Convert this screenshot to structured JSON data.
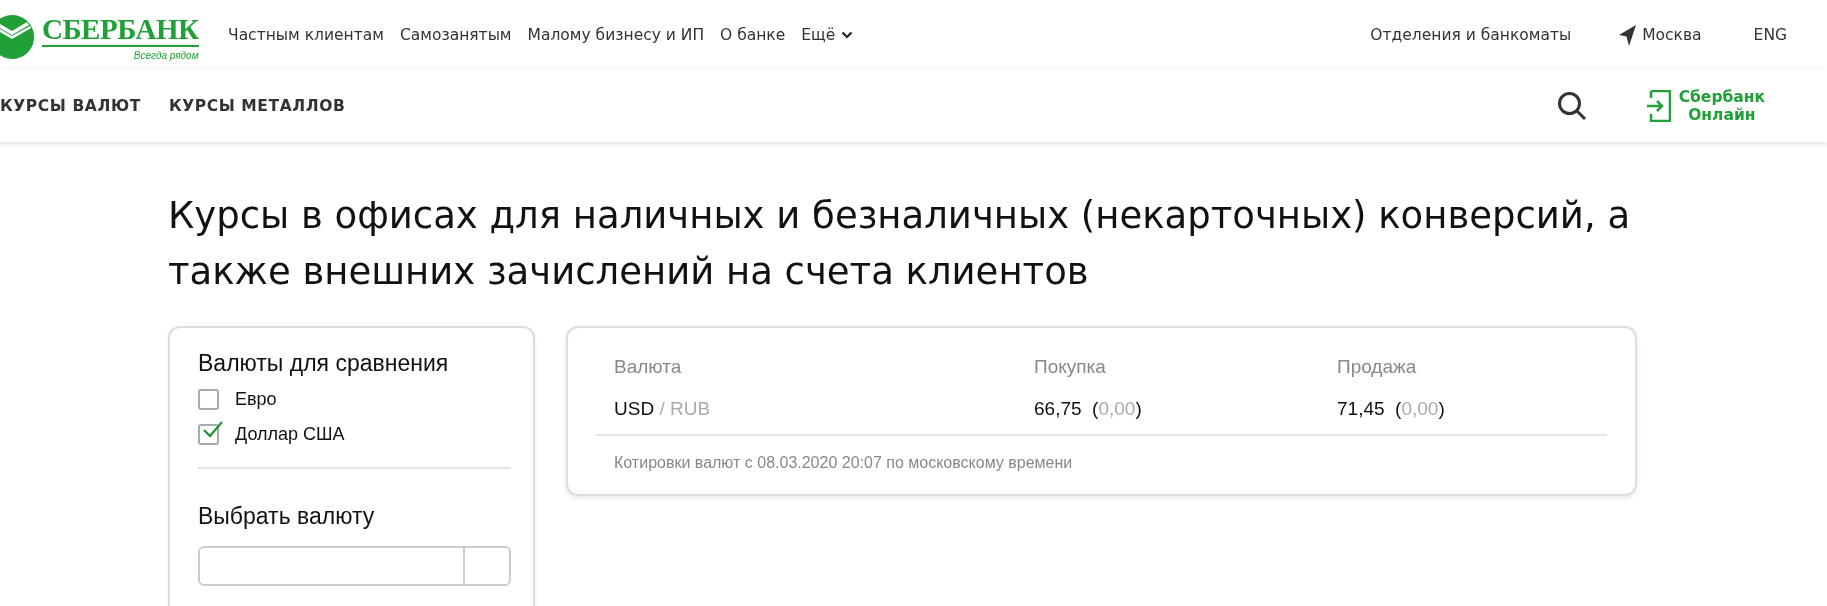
{
  "logo": {
    "name": "СБЕРБАНК",
    "slogan": "Всегда рядом"
  },
  "top_nav": [
    {
      "label": "Частным клиентам"
    },
    {
      "label": "Самозанятым"
    },
    {
      "label": "Малому бизнесу и ИП"
    },
    {
      "label": "О банке"
    },
    {
      "label": "Ещё",
      "kind": "dropdown"
    }
  ],
  "top_right": {
    "branches": "Отделения и банкоматы",
    "city": "Москва",
    "language": "ENG"
  },
  "sub_nav": [
    {
      "label": "КУРСЫ ВАЛЮТ"
    },
    {
      "label": "КУРСЫ МЕТАЛЛОВ"
    }
  ],
  "online_button": {
    "line1": "Сбербанк",
    "line2": "Онлайн"
  },
  "heading": "Курсы в офисах для наличных и безналичных (некарточных) конверсий, а также внешних зачислений на счета клиентов",
  "filter": {
    "title": "Валюты для сравнения",
    "options": [
      {
        "label": "Евро",
        "checked": false
      },
      {
        "label": "Доллар США",
        "checked": true
      }
    ],
    "select_title": "Выбрать валюту"
  },
  "rates": {
    "columns": [
      "Валюта",
      "Покупка",
      "Продажа"
    ],
    "rows": [
      {
        "base": "USD",
        "quote": "/ RUB",
        "buy": {
          "value": "66,75",
          "open": "(",
          "change": "0,00",
          "close": ")"
        },
        "sell": {
          "value": "71,45",
          "open": "(",
          "change": "0,00",
          "close": ")"
        }
      }
    ],
    "note": "Котировки валют с 08.03.2020 20:07 по московскому времени"
  }
}
